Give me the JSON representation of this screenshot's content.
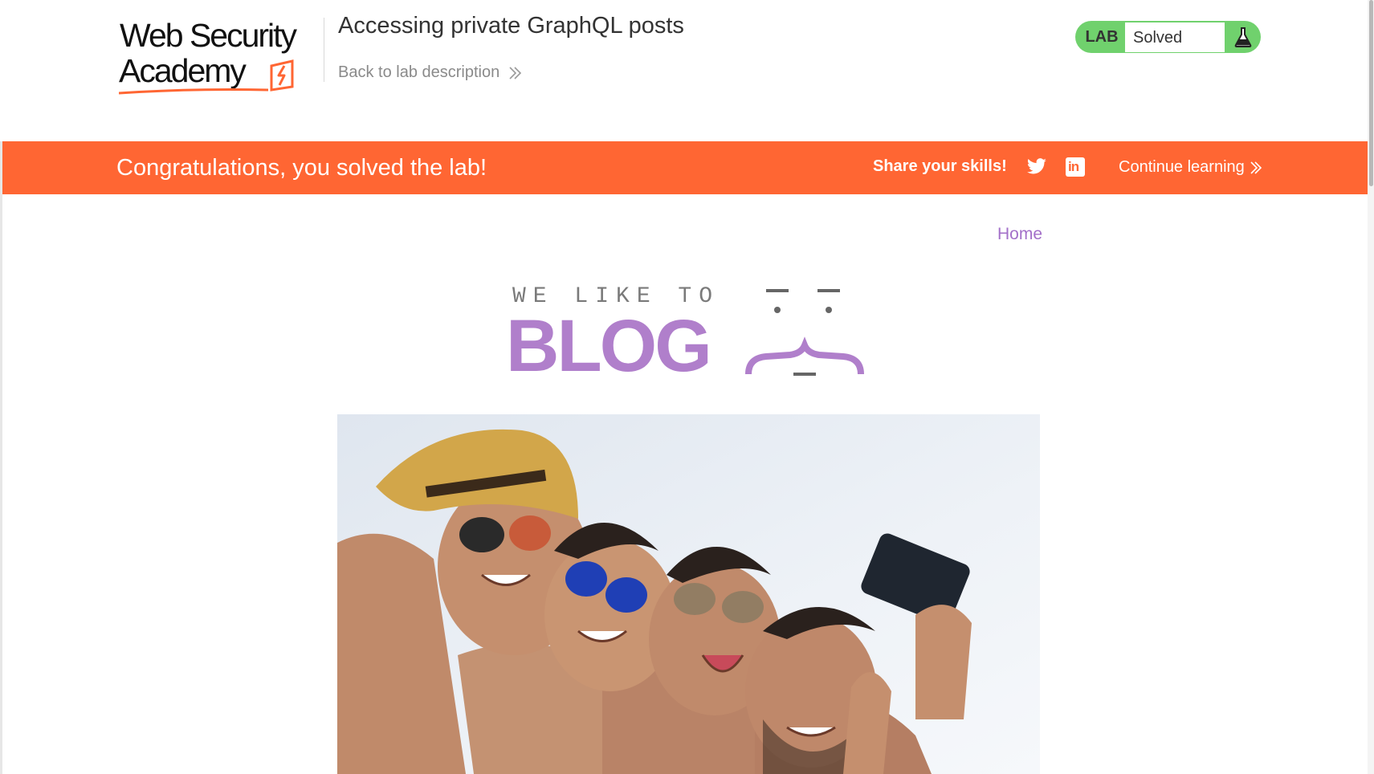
{
  "header": {
    "logo": {
      "line1": "Web Security",
      "line2": "Academy"
    },
    "lab_title": "Accessing private GraphQL posts",
    "back_link": "Back to lab description",
    "status": {
      "label": "LAB",
      "state": "Solved",
      "icon": "flask-icon"
    }
  },
  "banner": {
    "message": "Congratulations, you solved the lab!",
    "share_label": "Share your skills!",
    "twitter_icon": "twitter-icon",
    "linkedin_icon": "linkedin-icon",
    "linkedin_glyph": "in",
    "continue_label": "Continue learning"
  },
  "blog": {
    "nav": {
      "home": "Home"
    },
    "logo": {
      "tagline": "WE LIKE TO",
      "word": "BLOG"
    },
    "post_image": {
      "description_icon": "photo"
    }
  },
  "colors": {
    "banner": "#ff6633",
    "lab_badge": "#70d16d",
    "accent_purple": "#b07fcb",
    "link_purple": "#a370c9"
  }
}
